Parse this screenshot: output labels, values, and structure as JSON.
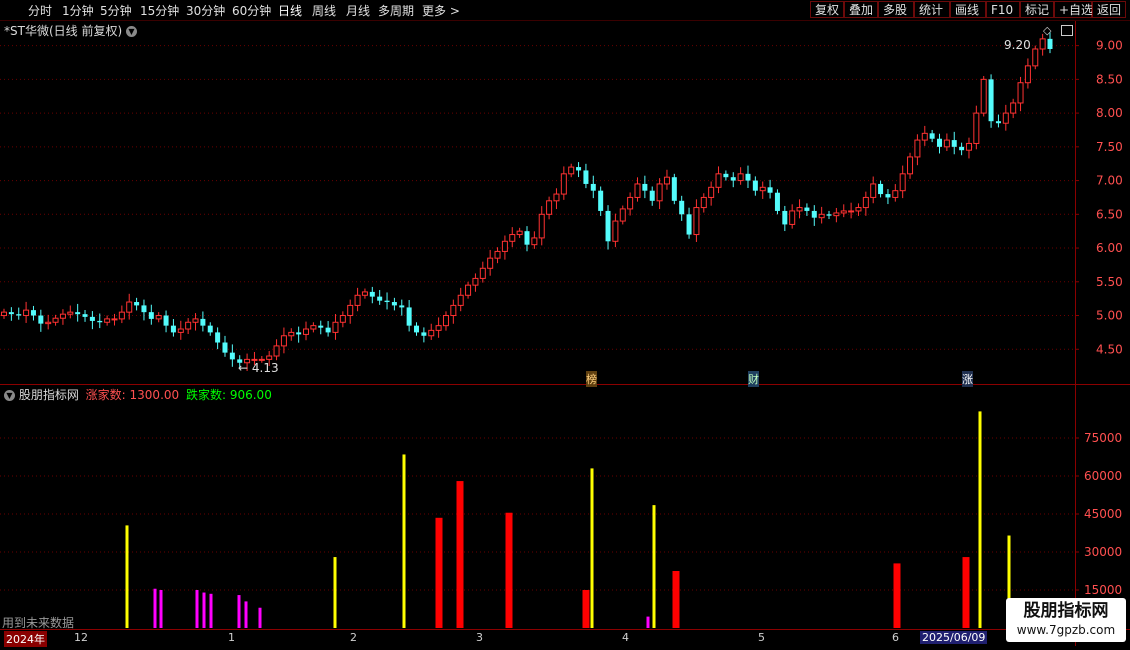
{
  "toolbar": {
    "periods": [
      "分时",
      "1分钟",
      "5分钟",
      "15分钟",
      "30分钟",
      "60分钟",
      "日线",
      "周线",
      "月线",
      "多周期",
      "更多 >"
    ],
    "active_period": "日线",
    "right_buttons": [
      "复权",
      "叠加",
      "多股",
      "统计",
      "画线",
      "F10",
      "标记",
      "+自选",
      "返回"
    ]
  },
  "main_header": {
    "title": "*ST华微(日线 前复权)"
  },
  "indicator_header": {
    "name": "股朋指标网",
    "up_label": "涨家数: 1300.00",
    "down_label": "跌家数: 906.00"
  },
  "annotations": {
    "high_label": "9.20",
    "low_label": "4.13",
    "future_note": "用到未来数据",
    "event_tags": [
      "榜",
      "财",
      "涨"
    ]
  },
  "time_axis": {
    "labels": [
      "2024年",
      "12",
      "1",
      "2",
      "3",
      "4",
      "5",
      "6",
      "2025/06/09"
    ]
  },
  "logo": {
    "line1": "股朋指标网",
    "line2": "www.7gpzb.com"
  },
  "colors": {
    "up": "#ff3232",
    "down": "#54fcfc",
    "grid": "#6a0000",
    "axis": "#8b0000",
    "yellow": "#ffff00",
    "red_bar": "#ff0000",
    "magenta": "#ff00ff",
    "label_up": "#ff5050",
    "label_down": "#00ff00"
  },
  "chart_data": [
    {
      "type": "candlestick",
      "title": "*ST华微(日线 前复权)",
      "y_ticks": [
        4.5,
        5.0,
        5.5,
        6.0,
        6.5,
        7.0,
        7.5,
        8.0,
        8.5,
        9.0
      ],
      "ylim": [
        4.0,
        9.35
      ],
      "marked_high": 9.2,
      "marked_low": 4.13,
      "close": [
        5.05,
        5.02,
        5.0,
        5.08,
        5.0,
        4.88,
        4.9,
        4.96,
        5.02,
        5.05,
        5.02,
        4.98,
        4.92,
        4.9,
        4.95,
        4.95,
        5.05,
        5.2,
        5.15,
        5.05,
        4.95,
        5.0,
        4.85,
        4.75,
        4.8,
        4.9,
        4.95,
        4.85,
        4.75,
        4.6,
        4.45,
        4.35,
        4.3,
        4.35,
        4.35,
        4.35,
        4.4,
        4.55,
        4.7,
        4.75,
        4.72,
        4.8,
        4.85,
        4.82,
        4.75,
        4.9,
        5.0,
        5.15,
        5.3,
        5.35,
        5.28,
        5.22,
        5.2,
        5.15,
        5.12,
        4.85,
        4.75,
        4.7,
        4.78,
        4.85,
        5.0,
        5.15,
        5.3,
        5.45,
        5.55,
        5.7,
        5.85,
        5.95,
        6.1,
        6.2,
        6.25,
        6.05,
        6.15,
        6.5,
        6.7,
        6.8,
        7.1,
        7.2,
        7.15,
        6.95,
        6.85,
        6.55,
        6.1,
        6.4,
        6.58,
        6.75,
        6.95,
        6.85,
        6.7,
        6.95,
        7.05,
        6.7,
        6.5,
        6.2,
        6.6,
        6.75,
        6.9,
        7.1,
        7.05,
        7.0,
        7.1,
        7.0,
        6.85,
        6.9,
        6.82,
        6.55,
        6.35,
        6.55,
        6.6,
        6.55,
        6.45,
        6.5,
        6.48,
        6.52,
        6.55,
        6.55,
        6.6,
        6.75,
        6.95,
        6.8,
        6.75,
        6.85,
        7.1,
        7.35,
        7.6,
        7.7,
        7.62,
        7.5,
        7.6,
        7.5,
        7.45,
        7.55,
        8.0,
        8.5,
        7.88,
        7.85,
        8.0,
        8.15,
        8.45,
        8.7,
        8.95,
        9.1,
        8.95
      ],
      "volume": [
        {
          "type": "bar",
          "color": "yellow",
          "values_x": [
            127,
            335,
            404,
            592,
            654,
            980,
            1009
          ],
          "values": [
            40500,
            28000,
            68500,
            63000,
            48500,
            85500,
            36500
          ]
        },
        {
          "type": "bar",
          "color": "red",
          "values_x": [
            439,
            460,
            509,
            586,
            676,
            897,
            966
          ],
          "values": [
            43500,
            58000,
            45500,
            15000,
            22500,
            25500,
            28000
          ]
        },
        {
          "type": "bar",
          "color": "magenta",
          "values_x": [
            155,
            161,
            197,
            204,
            211,
            239,
            246,
            260,
            648
          ],
          "values": [
            15500,
            15000,
            15000,
            14000,
            13500,
            13000,
            10500,
            8000,
            4500
          ]
        }
      ],
      "y2_ticks": [
        15000,
        30000,
        45000,
        60000,
        75000
      ]
    }
  ]
}
